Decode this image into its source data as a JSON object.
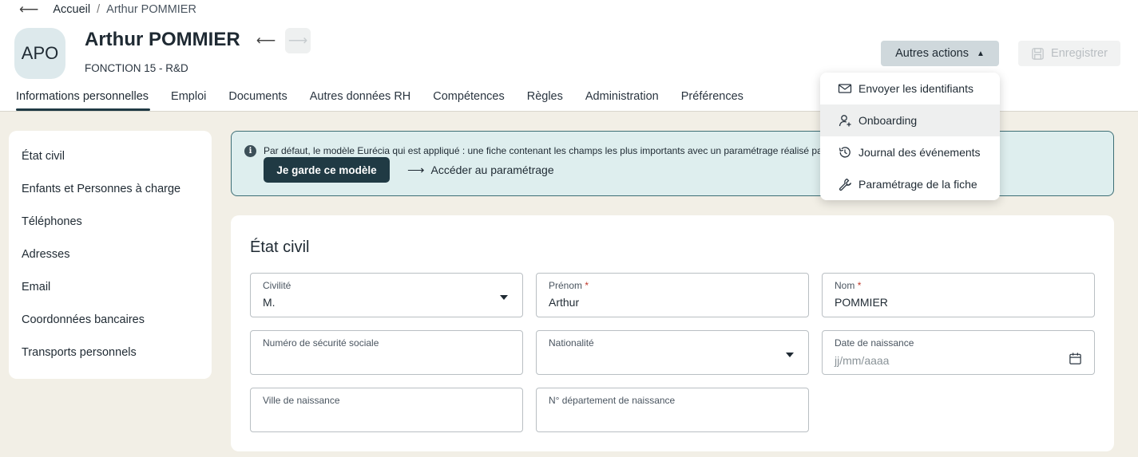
{
  "breadcrumb": {
    "home": "Accueil",
    "separator": "/",
    "current": "Arthur POMMIER"
  },
  "profile": {
    "initials": "APO",
    "name": "Arthur POMMIER",
    "subtitle": "FONCTION 15 - R&D"
  },
  "actions": {
    "more_label": "Autres actions",
    "save_label": "Enregistrer"
  },
  "tabs": [
    {
      "label": "Informations personnelles"
    },
    {
      "label": "Emploi"
    },
    {
      "label": "Documents"
    },
    {
      "label": "Autres données RH"
    },
    {
      "label": "Compétences"
    },
    {
      "label": "Règles"
    },
    {
      "label": "Administration"
    },
    {
      "label": "Préférences"
    }
  ],
  "sidebar": {
    "items": [
      {
        "label": "État civil"
      },
      {
        "label": "Enfants et Personnes à charge"
      },
      {
        "label": "Téléphones"
      },
      {
        "label": "Adresses"
      },
      {
        "label": "Email"
      },
      {
        "label": "Coordonnées bancaires"
      },
      {
        "label": "Transports personnels"
      }
    ]
  },
  "banner": {
    "icon_glyph": "i",
    "text": "Par défaut, le modèle Eurécia qui est appliqué : une fiche contenant les champs les plus importants avec un paramétrage réalisé par",
    "keep_label": "Je garde ce modèle",
    "link_label": "Accéder au paramétrage"
  },
  "form": {
    "title": "État civil",
    "required_mark": "*",
    "fields": {
      "civilite": {
        "label": "Civilité",
        "value": "M."
      },
      "prenom": {
        "label": "Prénom",
        "value": "Arthur"
      },
      "nom": {
        "label": "Nom",
        "value": "POMMIER"
      },
      "secu": {
        "label": "Numéro de sécurité sociale",
        "value": ""
      },
      "nationalite": {
        "label": "Nationalité",
        "value": ""
      },
      "naissance": {
        "label": "Date de naissance",
        "placeholder": "jj/mm/aaaa"
      },
      "ville": {
        "label": "Ville de naissance",
        "value": ""
      },
      "departement": {
        "label": "N° département de naissance",
        "value": ""
      }
    }
  },
  "menu": {
    "items": [
      {
        "label": "Envoyer les identifiants",
        "icon": "mail-icon"
      },
      {
        "label": "Onboarding",
        "icon": "user-add-icon"
      },
      {
        "label": "Journal des événements",
        "icon": "history-icon"
      },
      {
        "label": "Paramétrage de la fiche",
        "icon": "wrench-icon"
      }
    ]
  },
  "colors": {
    "primary": "#203a44",
    "page_bg": "#f2efe6",
    "banner_bg": "#deeeee",
    "required": "#c0392b"
  }
}
